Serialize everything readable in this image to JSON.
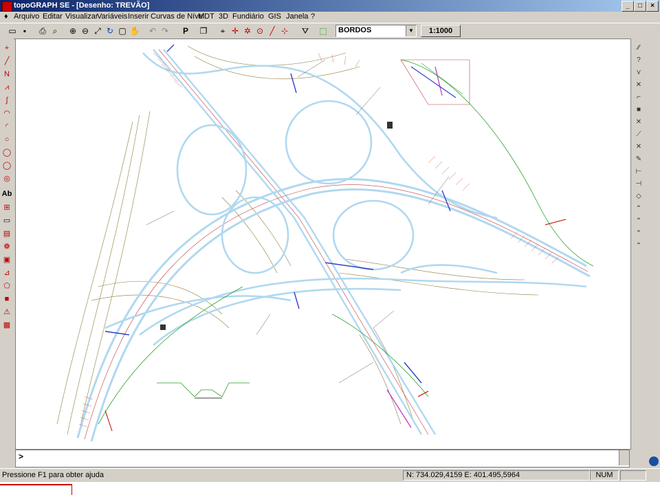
{
  "window": {
    "title": "topoGRAPH SE - [Desenho: TREVÃO]",
    "controls": {
      "minimize": "_",
      "maximize": "□",
      "close": "×"
    }
  },
  "menu": [
    {
      "label": "Arquivo"
    },
    {
      "label": "Editar"
    },
    {
      "label": "Visualizar"
    },
    {
      "label": "Variáveis"
    },
    {
      "label": "Inserir"
    },
    {
      "label": "Curvas de Nível"
    },
    {
      "label": "MDT"
    },
    {
      "label": "3D"
    },
    {
      "label": "Fundiário"
    },
    {
      "label": "GIS"
    },
    {
      "label": "Janela"
    },
    {
      "label": "?"
    }
  ],
  "toolbar": {
    "layer_combo": {
      "value": "BORDOS"
    },
    "scale_button": "1:1000",
    "icons": [
      "new-icon",
      "save-icon",
      "print-icon",
      "print-preview-icon",
      "zoom-in-icon",
      "zoom-out-icon",
      "zoom-extents-icon",
      "regen-icon",
      "zoom-window-icon",
      "pan-icon",
      "undo-icon",
      "redo-icon",
      "properties-icon",
      "layers-icon",
      "snap-icon",
      "snap-center-icon",
      "snap-end-icon",
      "snap-mid-icon",
      "line-tool-icon",
      "snap-perp-icon",
      "filter-icon",
      "select-icon"
    ]
  },
  "left_toolbar": [
    "point-icon",
    "line-icon",
    "polyline-icon",
    "multiline-icon",
    "spline-icon",
    "arc-icon",
    "arc3-icon",
    "circle-icon",
    "circle2-icon",
    "ellipse-icon",
    "text-icon",
    "block-icon",
    "rectangle-icon",
    "hatch-icon",
    "donut-icon",
    "insert-image-icon",
    "dimension-icon",
    "region-icon",
    "fill-icon",
    "symbol-icon"
  ],
  "left_text_tool": "Ab",
  "right_toolbar": [
    "trim-icon",
    "help-icon",
    "extend-icon",
    "erase-icon",
    "break-icon",
    "fillet-icon",
    "array-icon",
    "mirror-icon",
    "scale-icon",
    "rotate-icon",
    "stretch-icon",
    "offset-icon",
    "move-icon",
    "copy-icon",
    "explode-icon",
    "join-icon",
    "chamfer-icon"
  ],
  "command_line": {
    "prompt": ">"
  },
  "status": {
    "help": "Pressione F1 para obter ajuda",
    "coords": "N: 734.029,4159 E: 401.495,5964",
    "num": "NUM"
  }
}
